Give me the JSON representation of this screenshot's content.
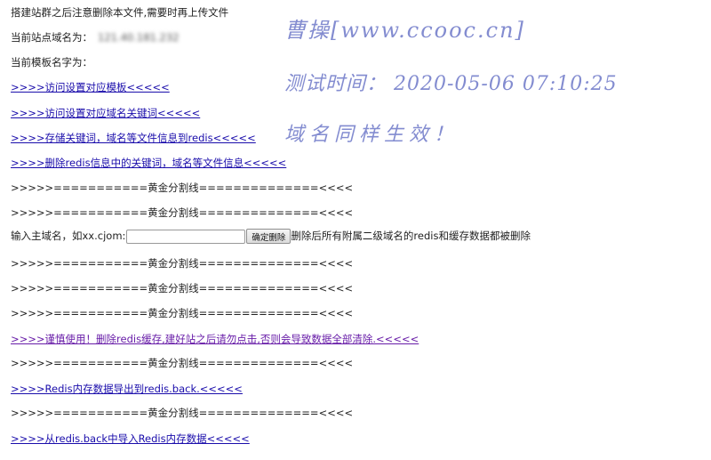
{
  "notice": "搭建站群之后注意删除本文件,需要时再上传文件",
  "current_domain": {
    "label": "当前站点域名为：",
    "value": "121.40.181.232"
  },
  "current_template": {
    "label": "当前模板名字为："
  },
  "links": {
    "template_settings": ">>>>访问设置对应模板<<<<<",
    "keyword_settings": ">>>>访问设置对应域名关键词<<<<<",
    "store_redis": ">>>>存储关键词，域名等文件信息到redis<<<<<",
    "delete_redis": ">>>>删除redis信息中的关键词，域名等文件信息<<<<<",
    "clear_cache": ">>>>谨慎使用！删除redis缓存,建好站之后请勿点击,否则会导致数据全部清除.<<<<<",
    "export_redis": ">>>>Redis内存数据导出到redis.back.<<<<<",
    "import_redis": ">>>>从redis.back中导入Redis内存数据<<<<<"
  },
  "separator": ">>>>>===========黄金分割线==============<<<<",
  "delete_form": {
    "label": "输入主域名，如xx.cjom:",
    "input_value": "",
    "button_label": "确定删除",
    "note": "删除后所有附属二级域名的redis和缓存数据都被删除"
  },
  "watermark": {
    "name": "曹操[www.ccooc.cn]",
    "time": "测试时间： 2020-05-06 07:10:25",
    "note": "域名同样生效！"
  },
  "colors": {
    "link": "#1a0dab",
    "visited_link": "#681da8",
    "watermark": "#6e78c8"
  }
}
